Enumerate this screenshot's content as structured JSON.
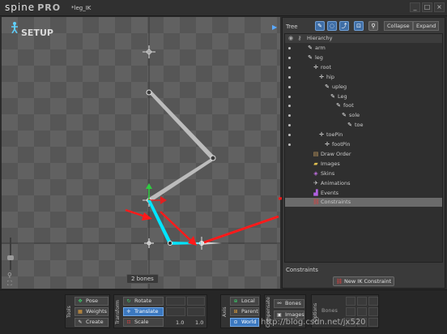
{
  "app": {
    "logo_text": "spine",
    "logo_pro": "PRO",
    "file_name": "*leg_IK",
    "window_buttons": [
      "_",
      "□",
      "×"
    ]
  },
  "viewport": {
    "mode_label": "SETUP",
    "play_icon": "play-arrow-icon",
    "bones_count": "2 bones",
    "zoom_icon": "magnifier-icon",
    "fit_icon": "fit-view-icon"
  },
  "tree": {
    "title": "Tree",
    "collapse_label": "Collapse",
    "expand_label": "Expand",
    "hierarchy_label": "Hierarchy",
    "rows": [
      {
        "label": "arm",
        "icon": "bone",
        "indent": 1,
        "visible": true
      },
      {
        "label": "leg",
        "icon": "bone",
        "indent": 1,
        "visible": true
      },
      {
        "label": "root",
        "icon": "cross",
        "indent": 2,
        "visible": true
      },
      {
        "label": "hip",
        "icon": "cross",
        "indent": 3,
        "visible": true
      },
      {
        "label": "upleg",
        "icon": "bone",
        "indent": 4,
        "visible": true
      },
      {
        "label": "Leg",
        "icon": "bone",
        "indent": 5,
        "visible": true
      },
      {
        "label": "foot",
        "icon": "bone",
        "indent": 6,
        "visible": true
      },
      {
        "label": "sole",
        "icon": "bone",
        "indent": 7,
        "visible": true
      },
      {
        "label": "toe",
        "icon": "bone",
        "indent": 8,
        "visible": true
      },
      {
        "label": "toePin",
        "icon": "cross",
        "indent": 3,
        "visible": true
      },
      {
        "label": "footPin",
        "icon": "cross",
        "indent": 4,
        "visible": true
      },
      {
        "label": "Draw Order",
        "icon": "draw",
        "indent": 2,
        "visible": false
      },
      {
        "label": "Images",
        "icon": "folder",
        "indent": 2,
        "visible": false
      },
      {
        "label": "Skins",
        "icon": "skin",
        "indent": 2,
        "visible": false
      },
      {
        "label": "Animations",
        "icon": "anim",
        "indent": 2,
        "visible": false
      },
      {
        "label": "Events",
        "icon": "event",
        "indent": 2,
        "visible": false
      },
      {
        "label": "Constraints",
        "icon": "constraint",
        "indent": 2,
        "visible": false,
        "selected": true
      }
    ],
    "constraints_title": "Constraints",
    "new_constraint_label": "New IK Constraint"
  },
  "toolbar": {
    "tools_label": "Tools",
    "pose_label": "Pose",
    "weights_label": "Weights",
    "create_label": "Create",
    "transform_label": "Transform",
    "rotate_label": "Rotate",
    "translate_label": "Translate",
    "scale_label": "Scale",
    "scale_x": "1.0",
    "scale_y": "1.0",
    "axis_label": "Axis",
    "local_label": "Local",
    "parent_label": "Parent",
    "world_label": "World",
    "compensate_label": "Compensate",
    "bones_label": "Bones",
    "images_label": "Images",
    "options_label": "Options",
    "options_bones": "Bones"
  },
  "watermark": "http://blog.csdn.net/jx520",
  "colors": {
    "accent_blue": "#3b78c0",
    "ik_cyan": "#00e5ff",
    "arrow_red": "#ff1a1a",
    "gizmo_green": "#2ecc40"
  }
}
